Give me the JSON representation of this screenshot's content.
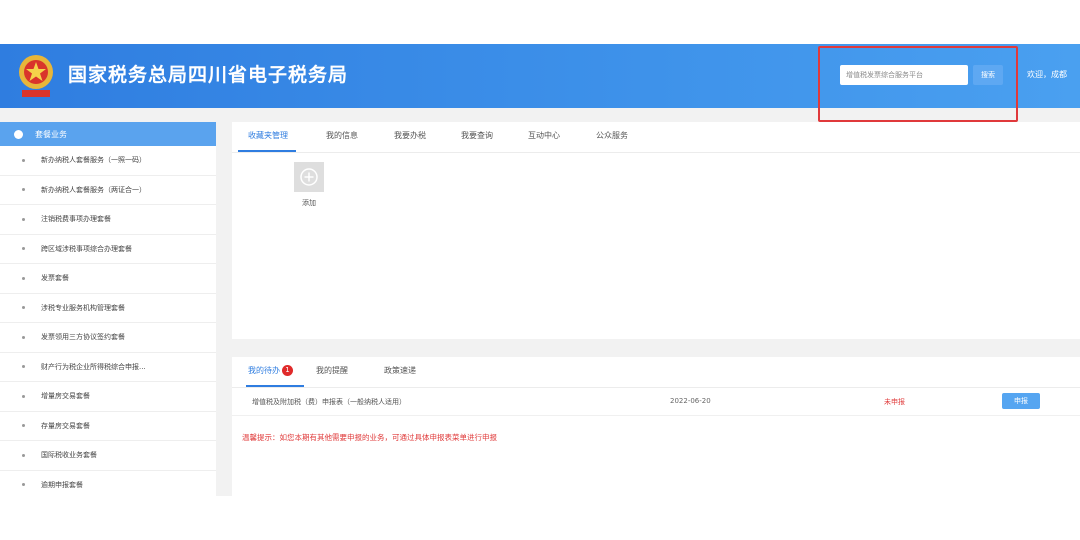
{
  "header": {
    "site_title": "国家税务总局四川省电子税务局",
    "search_placeholder": "增值税发票综合服务平台",
    "search_button": "搜索",
    "welcome": "欢迎，成都"
  },
  "sidebar": {
    "title": "套餐业务",
    "items": [
      {
        "label": "新办纳税人套餐服务（一照一码）"
      },
      {
        "label": "新办纳税人套餐服务（两证合一）"
      },
      {
        "label": "注销税费事项办理套餐"
      },
      {
        "label": "跨区域涉税事项综合办理套餐"
      },
      {
        "label": "发票套餐"
      },
      {
        "label": "涉税专业服务机构管理套餐"
      },
      {
        "label": "发票领用三方协议签约套餐"
      },
      {
        "label": "财产行为税企业所得税综合申报..."
      },
      {
        "label": "增量房交易套餐"
      },
      {
        "label": "存量房交易套餐"
      },
      {
        "label": "国际税收业务套餐"
      },
      {
        "label": "逾期申报套餐"
      }
    ]
  },
  "main": {
    "tabs": [
      {
        "label": "收藏夹管理"
      },
      {
        "label": "我的信息"
      },
      {
        "label": "我要办税"
      },
      {
        "label": "我要查询"
      },
      {
        "label": "互动中心"
      },
      {
        "label": "公众服务"
      }
    ],
    "add_label": "添加"
  },
  "todo": {
    "tabs": [
      {
        "label": "我的待办"
      },
      {
        "label": "我的提醒"
      },
      {
        "label": "政策速递"
      }
    ],
    "badge": "1",
    "rows": [
      {
        "name": "增值税及附加税（费）申报表（一般纳税人适用）",
        "date": "2022-06-20",
        "status": "未申报",
        "action": "申报"
      }
    ],
    "tip": "温馨提示：如您本期有其他需要申报的业务，可通过具体申报表菜单进行申报"
  },
  "colors": {
    "header_blue": "#2f7de0",
    "sidebar_header_blue": "#5aa3ee",
    "alert_red": "#e03b3b",
    "highlight_box_red": "#e0393b"
  }
}
